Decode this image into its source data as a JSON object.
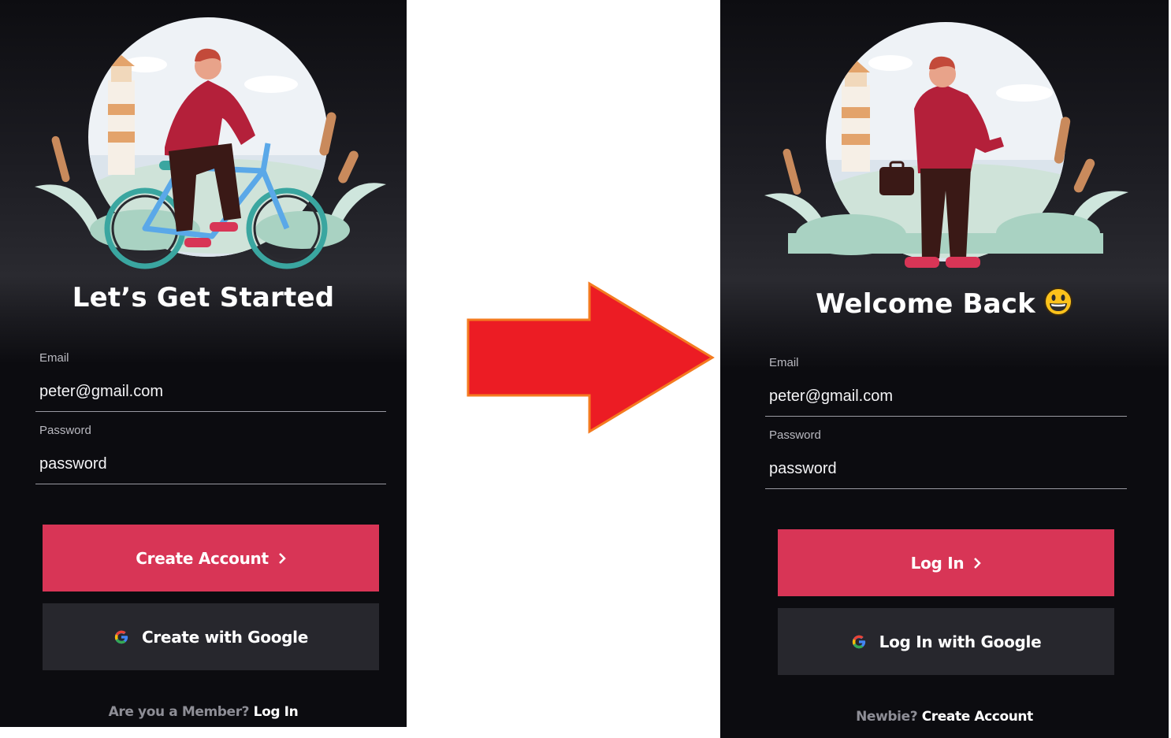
{
  "colors": {
    "background": "#0c0c10",
    "primary_button": "#d83556",
    "secondary_button": "#27272d",
    "arrow_fill": "#ec1c24",
    "arrow_stroke": "#f47b20"
  },
  "signup": {
    "headline": "Let’s Get Started",
    "illustration": "man-riding-bicycle-illustration",
    "email_label": "Email",
    "email_value": "peter@gmail.com",
    "password_label": "Password",
    "password_value": "password",
    "primary_button": "Create Account",
    "google_button": "Create with Google",
    "footer_prompt": "Are you a Member?",
    "footer_link": "Log In"
  },
  "transition": {
    "icon": "right-arrow-icon"
  },
  "login": {
    "headline": "Welcome Back",
    "headline_emoji": "grinning-face-emoji",
    "illustration": "man-with-briefcase-illustration",
    "email_label": "Email",
    "email_value": "peter@gmail.com",
    "password_label": "Password",
    "password_value": "password",
    "primary_button": "Log In",
    "google_button": "Log In with Google",
    "footer_prompt": "Newbie?",
    "footer_link": "Create Account"
  }
}
